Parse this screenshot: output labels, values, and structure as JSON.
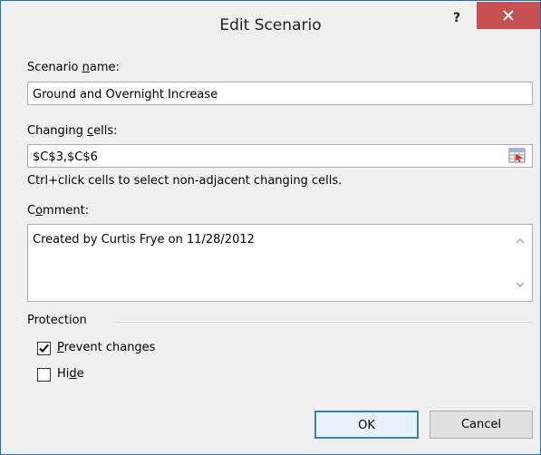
{
  "dialog": {
    "title": "Edit Scenario",
    "help_label": "?",
    "close_label": "✕"
  },
  "scenario_name": {
    "label_pre": "Scenario ",
    "label_u": "n",
    "label_post": "ame:",
    "value": "Ground and Overnight Increase"
  },
  "changing_cells": {
    "label_pre": "Changing ",
    "label_u": "c",
    "label_post": "ells:",
    "value": "$C$3,$C$6",
    "refedit_icon": "collapse-range-icon",
    "hint": "Ctrl+click cells to select non-adjacent changing cells."
  },
  "comment": {
    "label_pre": "C",
    "label_u": "o",
    "label_post": "mment:",
    "value": "Created by Curtis Frye on 11/28/2012"
  },
  "protection": {
    "label": "Protection",
    "prevent_changes": {
      "label_pre": "",
      "label_u": "P",
      "label_post": "revent changes",
      "checked": true
    },
    "hide": {
      "label_pre": "Hi",
      "label_u": "d",
      "label_post": "e",
      "checked": false
    }
  },
  "buttons": {
    "ok": "OK",
    "cancel": "Cancel"
  },
  "colors": {
    "close_button": "#c75050",
    "border": "#1e71b8",
    "ok_border": "#3c7fb1"
  }
}
